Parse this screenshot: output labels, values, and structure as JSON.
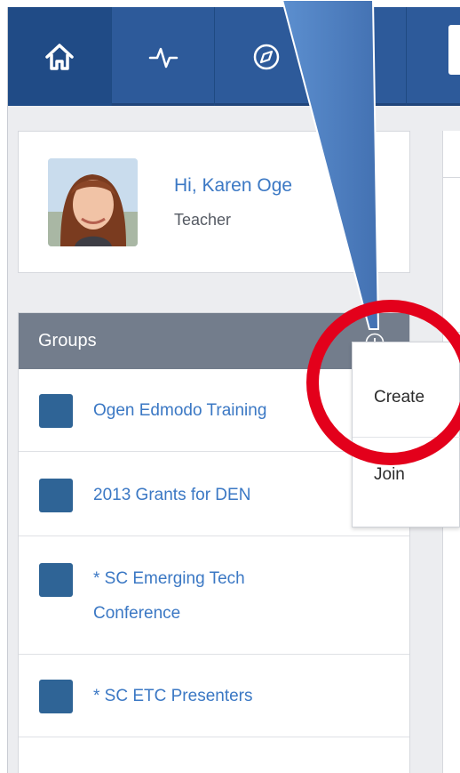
{
  "nav": {
    "items": [
      {
        "name": "home",
        "icon": "home-icon"
      },
      {
        "name": "activity",
        "icon": "pulse-icon"
      },
      {
        "name": "discover",
        "icon": "compass-icon"
      },
      {
        "name": "extra",
        "icon": "square-icon"
      }
    ],
    "colors": {
      "bar": "#2d5a9a",
      "active": "#204b86"
    }
  },
  "profile": {
    "greeting": "Hi, Karen Oge",
    "role": "Teacher"
  },
  "groups": {
    "title": "Groups",
    "add_icon": "plus-circle-icon",
    "items": [
      {
        "label": "Ogen Edmodo Training"
      },
      {
        "label": "2013 Grants for DEN"
      },
      {
        "label": "* SC Emerging Tech Conference"
      },
      {
        "label": "* SC ETC Presenters"
      }
    ]
  },
  "dropdown": {
    "items": [
      {
        "label": "Create"
      },
      {
        "label": "Join"
      }
    ]
  },
  "annotation": {
    "highlight_color": "#e3001b",
    "pointer_color": "#4f7fbf"
  }
}
